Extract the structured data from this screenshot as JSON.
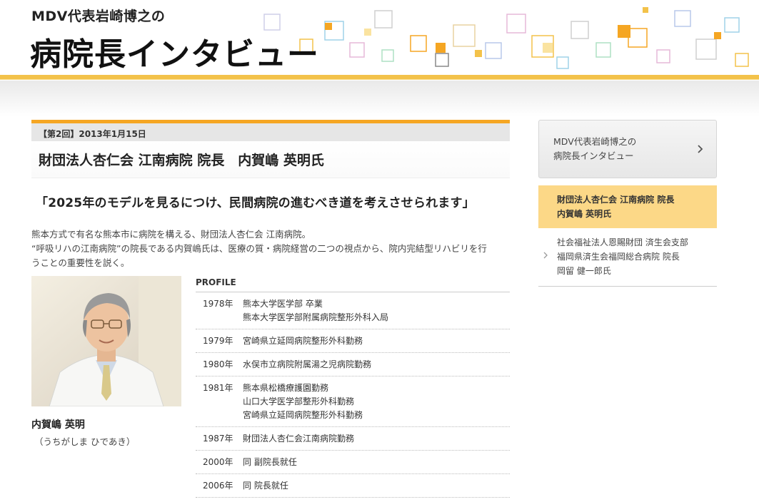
{
  "header": {
    "subtitle": "MDV代表岩崎博之の",
    "title": "病院長インタビュー"
  },
  "article": {
    "date_label": "【第2回】2013年1月15日",
    "interviewee": "財団法人杏仁会 江南病院 院長　内賀嶋 英明氏",
    "headline": "「2025年のモデルを見るにつけ、民間病院の進むべき道を考えさせられます」",
    "lead": [
      "熊本方式で有名な熊本市に病院を構える、財団法人杏仁会 江南病院。",
      "“呼吸リハの江南病院”の院長である内賀嶋氏は、医療の質・病院経営の二つの視点から、院内完結型リハビリを行",
      "うことの重要性を説く。"
    ],
    "person_name": "内賀嶋 英明",
    "person_kana": "（うちがしま ひであき）",
    "profile_heading": "PROFILE",
    "career": [
      {
        "year": "1978年",
        "lines": [
          "熊本大学医学部 卒業",
          "熊本大学医学部附属病院整形外科入局"
        ]
      },
      {
        "year": "1979年",
        "lines": [
          "宮崎県立延岡病院整形外科勤務"
        ]
      },
      {
        "year": "1980年",
        "lines": [
          "水俣市立病院附属湯之児病院勤務"
        ]
      },
      {
        "year": "1981年",
        "lines": [
          "熊本県松橋療護園勤務",
          "山口大学医学部整形外科勤務",
          "宮崎県立延岡病院整形外科勤務"
        ]
      },
      {
        "year": "1987年",
        "lines": [
          "財団法人杏仁会江南病院勤務"
        ]
      },
      {
        "year": "2000年",
        "lines": [
          "同 副院長就任"
        ]
      },
      {
        "year": "2006年",
        "lines": [
          "同 院長就任"
        ]
      }
    ]
  },
  "sidebar": {
    "series_link": [
      "MDV代表岩崎博之の",
      "病院長インタビュー"
    ],
    "current_item": [
      "財団法人杏仁会 江南病院 院長",
      "内賀嶋 英明氏"
    ],
    "other_item": [
      "社会福祉法人恩賜財団 済生会支部",
      "福岡県済生会福岡総合病院 院長",
      "岡留 健一郎氏"
    ]
  },
  "colors": {
    "accent_orange": "#f5a623",
    "header_band": "#f3c24a",
    "current_item_bg": "#fcd887"
  }
}
